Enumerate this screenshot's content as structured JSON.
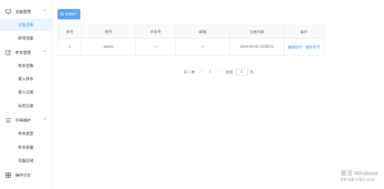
{
  "sidebar": {
    "groups": [
      {
        "label": "设备管理",
        "icon": "monitor-icon",
        "items": [
          "设备查看",
          "新增设备"
        ]
      },
      {
        "label": "样本管理",
        "icon": "edit-icon",
        "items": [
          "样本查看",
          "录入样本",
          "录入记录",
          "出库记录"
        ]
      },
      {
        "label": "字典维护",
        "icon": "list-icon",
        "items": [
          "样本类型",
          "样本容量",
          "设备区域"
        ]
      }
    ],
    "footer_item": {
      "label": "操作日志",
      "icon": "grid-icon"
    },
    "active_item": "设备查看",
    "chevron": "^"
  },
  "toolbar": {
    "add_button": "新增账户",
    "add_icon": "plus-circle-icon"
  },
  "table": {
    "columns": [
      "序号",
      "账号",
      "手机号",
      "邮箱",
      "注册日期",
      "操作"
    ],
    "rows": [
      {
        "index": "1",
        "account": "admin",
        "phone": "—",
        "email": "—",
        "date": "2024-09-09 13:09:22",
        "edit": "编辑账号",
        "delete": "删除账号"
      }
    ]
  },
  "pagination": {
    "total": "共 1 条",
    "prev": "<",
    "page": "1",
    "next": ">",
    "goto": "前往",
    "page_input": "1",
    "page_unit": "页"
  },
  "watermark": {
    "line1": "激活 Windows",
    "line2": "转到\"设置\"以激活 Windo"
  },
  "colors": {
    "primary": "#409eff",
    "button": "#5ba5f3",
    "active_bg": "#ecf5ff"
  }
}
